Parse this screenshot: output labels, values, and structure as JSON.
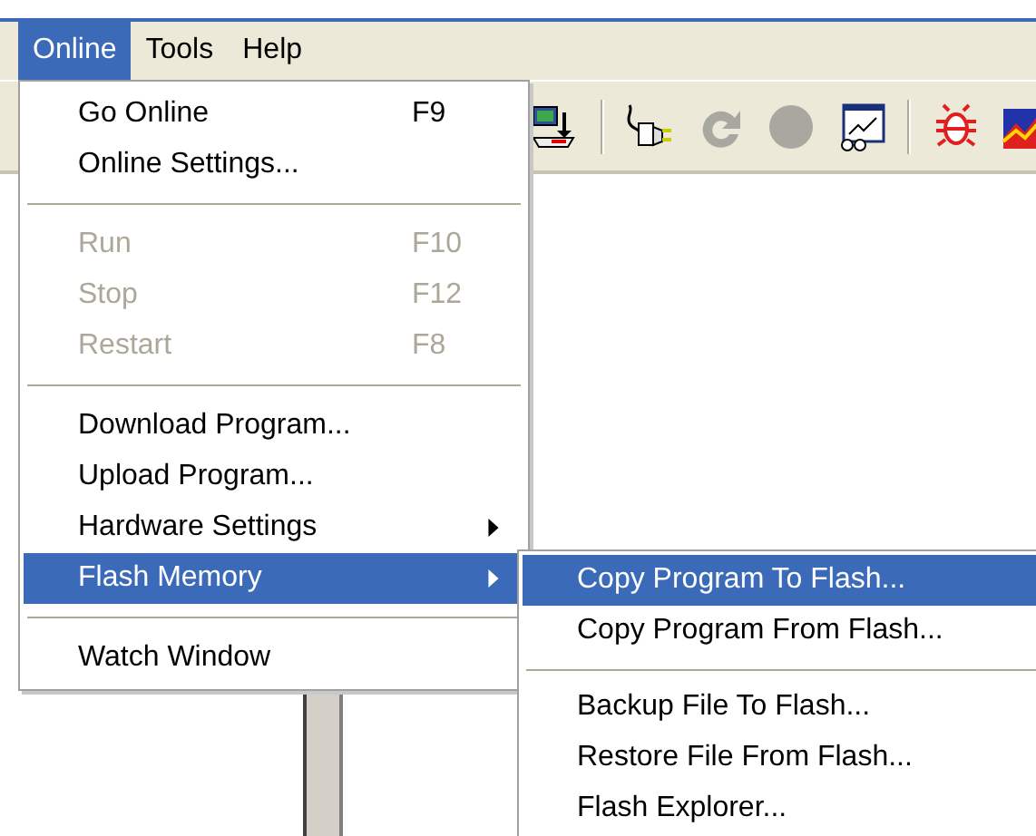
{
  "menubar": [
    {
      "label": "Online",
      "selected": true
    },
    {
      "label": "Tools",
      "selected": false
    },
    {
      "label": "Help",
      "selected": false
    }
  ],
  "menu": {
    "items": [
      {
        "kind": "item",
        "label": "Go Online",
        "shortcut": "F9",
        "disabled": false,
        "selected": false,
        "submenu": false
      },
      {
        "kind": "item",
        "label": "Online Settings...",
        "disabled": false,
        "selected": false,
        "submenu": false
      },
      {
        "kind": "separator"
      },
      {
        "kind": "item",
        "label": "Run",
        "shortcut": "F10",
        "disabled": true,
        "selected": false,
        "submenu": false
      },
      {
        "kind": "item",
        "label": "Stop",
        "shortcut": "F12",
        "disabled": true,
        "selected": false,
        "submenu": false
      },
      {
        "kind": "item",
        "label": "Restart",
        "shortcut": "F8",
        "disabled": true,
        "selected": false,
        "submenu": false
      },
      {
        "kind": "separator"
      },
      {
        "kind": "item",
        "label": "Download Program...",
        "disabled": false,
        "selected": false,
        "submenu": false
      },
      {
        "kind": "item",
        "label": "Upload Program...",
        "disabled": false,
        "selected": false,
        "submenu": false
      },
      {
        "kind": "item",
        "label": "Hardware Settings",
        "disabled": false,
        "selected": false,
        "submenu": true
      },
      {
        "kind": "item",
        "label": "Flash Memory",
        "disabled": false,
        "selected": true,
        "submenu": true
      },
      {
        "kind": "separator"
      },
      {
        "kind": "item",
        "label": "Watch Window",
        "disabled": false,
        "selected": false,
        "submenu": false
      }
    ]
  },
  "submenu": {
    "items": [
      {
        "kind": "item",
        "label": "Copy Program To Flash...",
        "selected": true
      },
      {
        "kind": "item",
        "label": "Copy Program From Flash...",
        "selected": false
      },
      {
        "kind": "separator"
      },
      {
        "kind": "item",
        "label": "Backup File To Flash...",
        "selected": false
      },
      {
        "kind": "item",
        "label": "Restore File From Flash...",
        "selected": false
      },
      {
        "kind": "item",
        "label": "Flash Explorer...",
        "selected": false
      }
    ]
  }
}
